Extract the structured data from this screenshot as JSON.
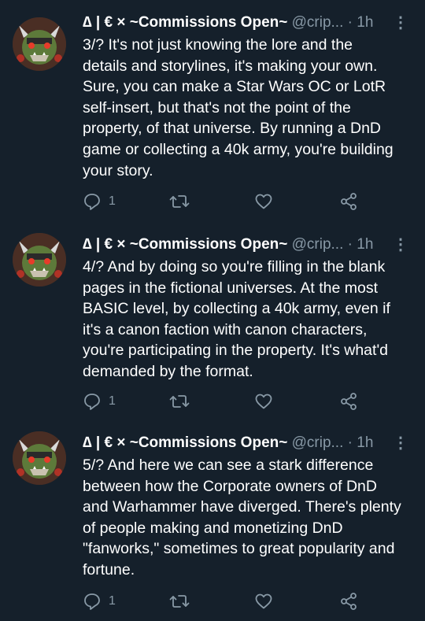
{
  "tweets": [
    {
      "display_name": "∆ | € × ~Commissions Open~",
      "handle": "@crip...",
      "dot": "·",
      "time": "1h",
      "more": "⋮",
      "lines": [
        "3/? It's not just knowing the lore and the",
        "details and storylines, it's making your own.",
        "Sure, you can make a Star Wars OC or LotR",
        "self-insert, but that's not the point of the",
        "property, of that universe. By running a DnD",
        "game or collecting a 40k army, you're building",
        "your story."
      ],
      "reply_count": "1"
    },
    {
      "display_name": "∆ | € × ~Commissions Open~",
      "handle": "@crip...",
      "dot": "·",
      "time": "1h",
      "more": "⋮",
      "lines": [
        "4/? And by doing so you're filling in the blank",
        "pages in the fictional universes. At the most",
        "BASIC level, by collecting a 40k army, even if",
        "it's a canon faction with canon characters,",
        "you're participating in the property. It's what'd",
        "demanded by the format."
      ],
      "reply_count": "1"
    },
    {
      "display_name": "∆ | € × ~Commissions Open~",
      "handle": "@crip...",
      "dot": "·",
      "time": "1h",
      "more": "⋮",
      "lines": [
        "5/? And here we can see a stark difference",
        "between how the Corporate owners of DnD",
        "and Warhammer have diverged. There's plenty",
        "of people making and monetizing DnD",
        "\"fanworks,\" sometimes to great popularity and",
        "fortune."
      ],
      "reply_count": "1"
    }
  ],
  "icons": {
    "reply": "reply-icon",
    "retweet": "retweet-icon",
    "like": "heart-icon",
    "share": "share-icon",
    "more": "more-vertical-icon"
  },
  "colors": {
    "background": "#15202b",
    "text": "#ffffff",
    "muted": "#8899a6"
  }
}
